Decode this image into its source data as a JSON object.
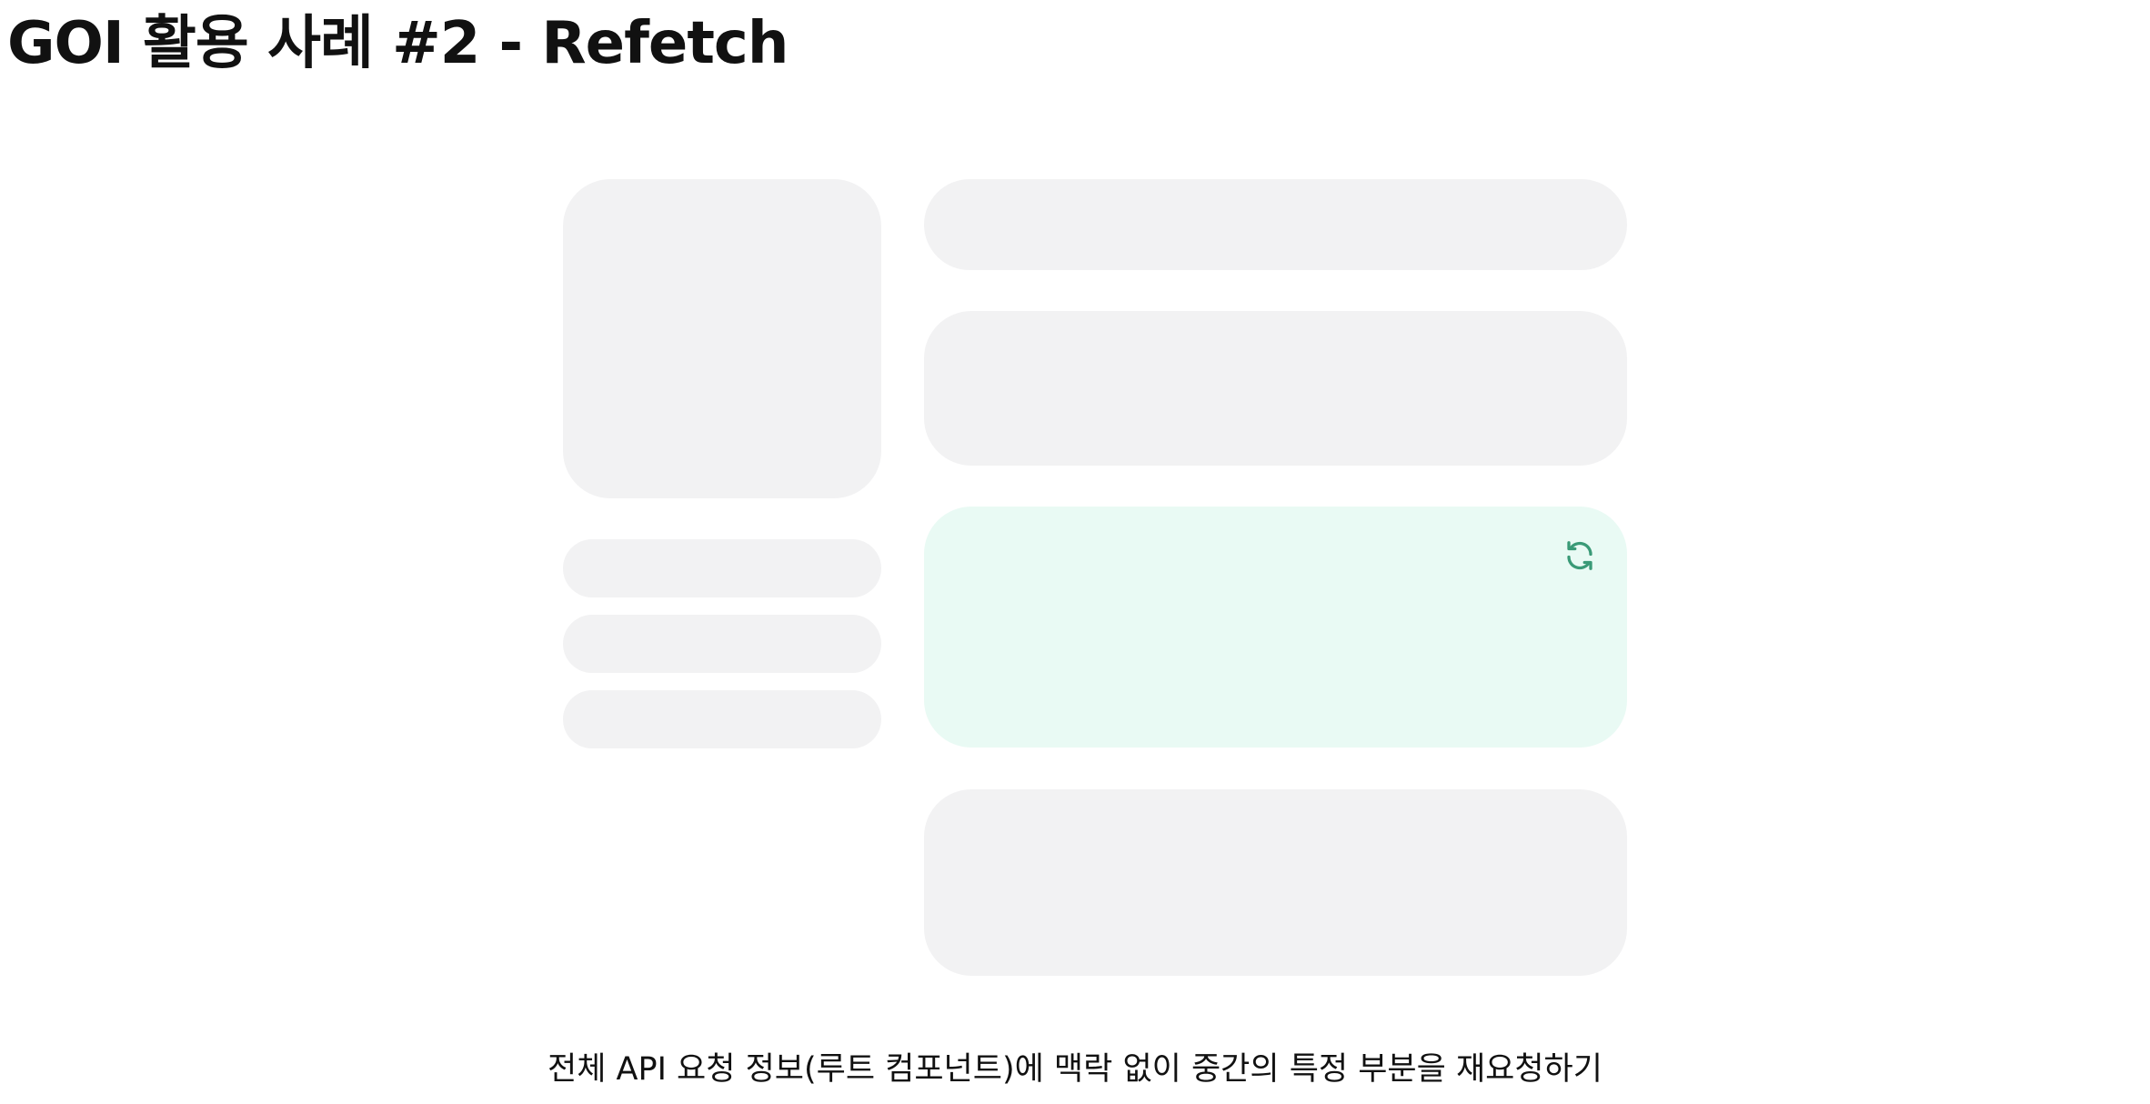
{
  "page": {
    "title": "GOI 활용 사례 #2 - Refetch",
    "caption": "전체 API 요청 정보(루트 컴포넌트)에 맥락 없이 중간의 특정 부분을 재요청하기"
  },
  "icons": {
    "refetch": "refresh-icon"
  },
  "colors": {
    "block": "#f2f2f3",
    "highlight_block": "#e9faf4",
    "highlight_icon": "#3a9a77",
    "text": "#111111"
  }
}
